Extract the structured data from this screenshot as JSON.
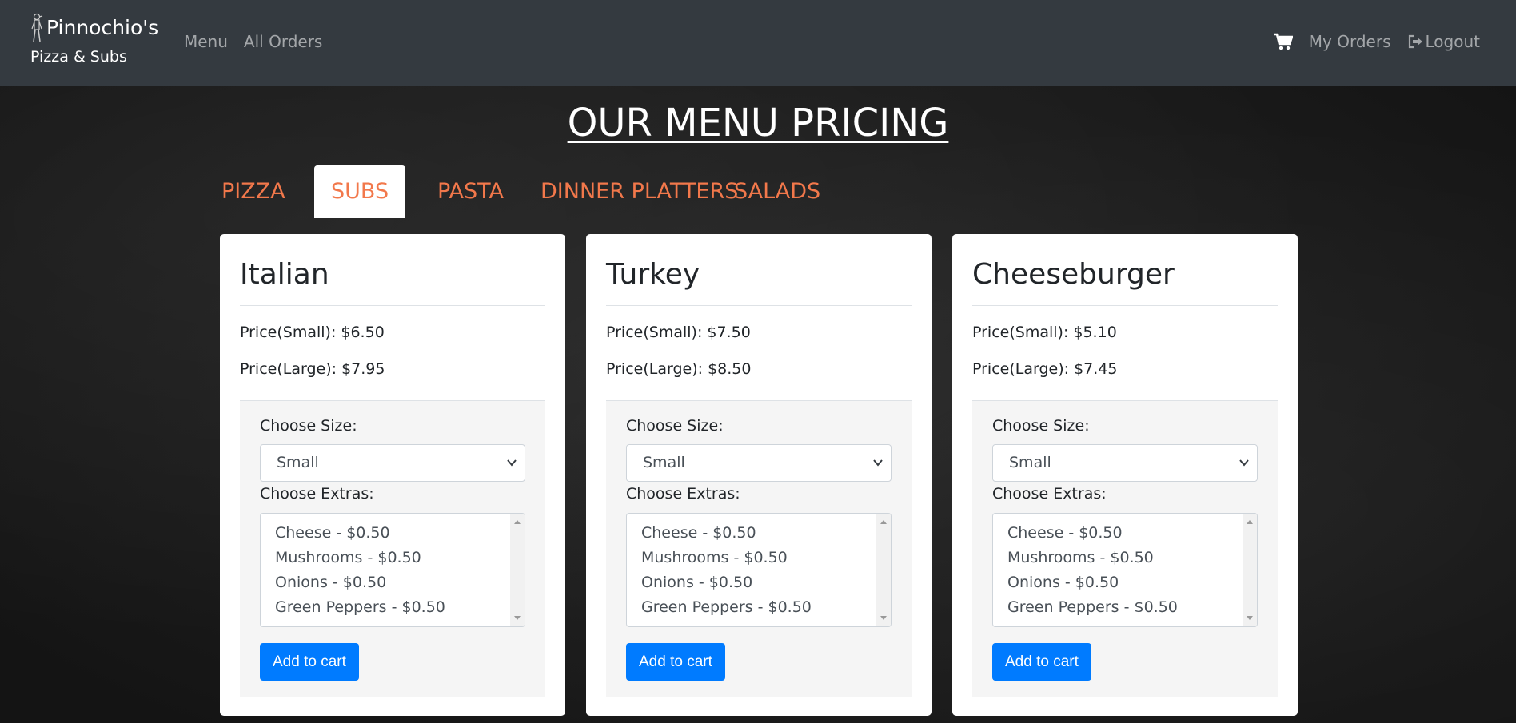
{
  "brand": {
    "name": "Pinnochio's",
    "subtitle": "Pizza & Subs"
  },
  "nav": {
    "left": [
      "Menu",
      "All Orders"
    ],
    "my_orders": "My Orders",
    "logout": "Logout",
    "icons": {
      "cart": "cart-icon",
      "logout": "logout-icon",
      "logo": "pinocchio-logo-icon"
    }
  },
  "page": {
    "title": "OUR MENU PRICING"
  },
  "tabs": [
    {
      "label": "PIZZA",
      "active": false
    },
    {
      "label": "SUBS",
      "active": true
    },
    {
      "label": "PASTA",
      "active": false
    },
    {
      "label": "DINNER PLATTERS",
      "active": false
    },
    {
      "label": "SALADS",
      "active": false
    }
  ],
  "colors": {
    "accent": "#f2784b",
    "button": "#007bff",
    "navbar": "#343a40"
  },
  "form": {
    "size_label": "Choose Size:",
    "extras_label": "Choose Extras:",
    "button_label": "Add to cart"
  },
  "items": [
    {
      "name": "Italian",
      "price_small": "Price(Small): $6.50",
      "price_large": "Price(Large): $7.95",
      "size": "Small",
      "extras": [
        "Cheese - $0.50",
        "Mushrooms - $0.50",
        "Onions - $0.50",
        "Green Peppers - $0.50"
      ]
    },
    {
      "name": "Turkey",
      "price_small": "Price(Small): $7.50",
      "price_large": "Price(Large): $8.50",
      "size": "Small",
      "extras": [
        "Cheese - $0.50",
        "Mushrooms - $0.50",
        "Onions - $0.50",
        "Green Peppers - $0.50"
      ]
    },
    {
      "name": "Cheeseburger",
      "price_small": "Price(Small): $5.10",
      "price_large": "Price(Large): $7.45",
      "size": "Small",
      "extras": [
        "Cheese - $0.50",
        "Mushrooms - $0.50",
        "Onions - $0.50",
        "Green Peppers - $0.50"
      ]
    }
  ]
}
